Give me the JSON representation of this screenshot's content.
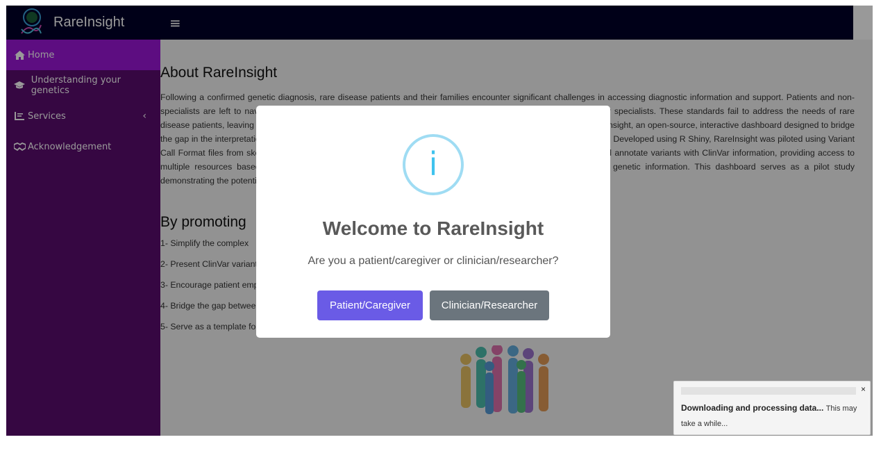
{
  "header": {
    "app_title": "RareInsight",
    "menu_icon": "hamburger-icon"
  },
  "sidebar": {
    "items": [
      {
        "label": "Home",
        "icon": "home-icon",
        "active": true
      },
      {
        "label": "Understanding your genetics",
        "icon": "graduation-cap-icon"
      },
      {
        "label": "Services",
        "icon": "list-icon",
        "expandable": true
      },
      {
        "label": "Acknowledgement",
        "icon": "handshake-icon"
      }
    ]
  },
  "main": {
    "about_heading": "About RareInsight",
    "about_paragraph": "Following a confirmed genetic diagnosis, rare disease patients and their families encounter significant challenges in accessing diagnostic information and support. Patients and non-specialists are left to navigate complex genetic databases and reporting standards which are primarily designed for specialists. These standards fail to address the needs of rare disease patients, leaving them with limited options for understanding of genetic results. This research introduces RareInsight, an open-source, interactive dashboard designed to bridge the gap in the interpretation and understanding of genetic data among patients, caregivers, clinicians, and researchers. Developed using R Shiny, RareInsight was piloted using Variant Call Format files from skeletal dysplasia patients. It allows users to input and view Variant Call Format files, filter and annotate variants with ClinVar information, providing access to multiple resources based on search terms. RareInsight aims to simplify the process of understanding complex genetic information. This dashboard serves as a pilot study demonstrating the potential of patient-centred tools in genomics.",
    "promoting_heading": "By promoting",
    "list": [
      "1- Simplify the complex",
      "2- Present ClinVar variants in a way that is accessible to patients and non-specialists.",
      "3- Encourage patient empowerment and engagement in rare disease research in Africa.",
      "4- Bridge the gap between genetic information and accessible, reliable educational resources.",
      "5- Serve as a template fo"
    ]
  },
  "modal": {
    "icon": "info-icon",
    "icon_glyph": "i",
    "title": "Welcome to RareInsight",
    "question": "Are you a patient/caregiver or clinician/researcher?",
    "button_patient": "Patient/Caregiver",
    "button_clinician": "Clinician/Researcher"
  },
  "toast": {
    "title": "Downloading and processing data...",
    "message_a": "This may",
    "message_b": "take a while...",
    "close_glyph": "×"
  },
  "colors": {
    "header": "#000028",
    "sidebar": "#5a0d6e",
    "sidebar_active": "#9b17d8",
    "primary_button": "#6a5be6",
    "secondary_button": "#6b757d",
    "info_icon": "#3fc3ee"
  }
}
